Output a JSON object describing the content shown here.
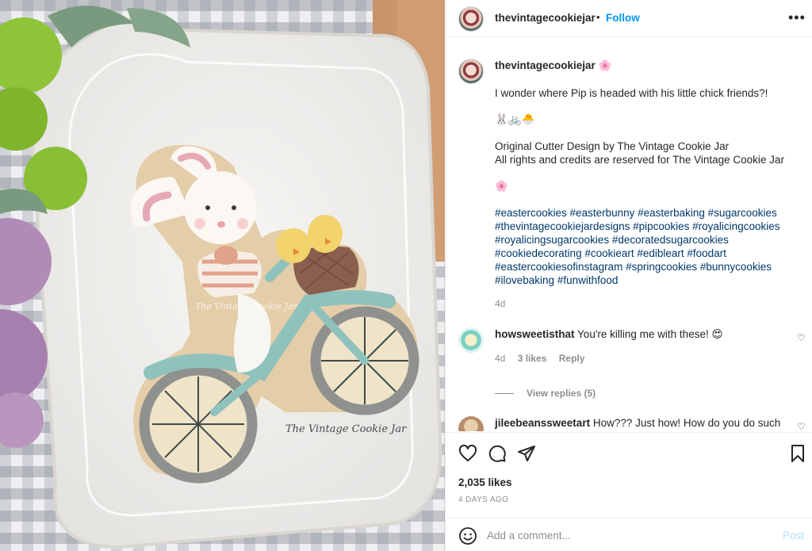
{
  "header": {
    "username": "thevintagecookiejar",
    "separator": "•",
    "follow_label": "Follow",
    "more_icon": "more-horizontal-icon",
    "more_glyph": "•••"
  },
  "photo": {
    "watermark_small": "The Vintage Cookie Jar",
    "watermark": "The Vintage Cookie Jar"
  },
  "caption": {
    "username": "thevintagecookiejar",
    "flower": "🌸",
    "line1": "I wonder where Pip is headed with his little chick friends?!",
    "emojis": "🐰🚲🐣",
    "line2": "Original Cutter Design by The Vintage Cookie Jar",
    "line3": "All rights and credits are reserved for The Vintage Cookie Jar",
    "flower2": "🌸",
    "hashtags": [
      "#eastercookies #easterbunny #easterbaking #sugarcookies",
      "#thevintagecookiejardesigns #pipcookies #royalicingcookies",
      "#royalicingsugarcookies #decoratedsugarcookies",
      "#cookiedecorating #cookieart #edibleart #foodart",
      "#eastercookiesofinstagram #springcookies #bunnycookies",
      "#ilovebaking #funwithfood"
    ],
    "time": "4d"
  },
  "comments": [
    {
      "username": "howsweetisthat",
      "text": "You're killing me with these! 😍",
      "time": "4d",
      "likes": "3 likes",
      "reply": "Reply",
      "view_replies": "View replies (5)"
    },
    {
      "username": "jileebeanssweetart",
      "text": "How??? Just how! How do you do such"
    }
  ],
  "actions": {
    "like_icon": "heart-icon",
    "comment_icon": "comment-icon",
    "share_icon": "share-icon",
    "save_icon": "bookmark-icon",
    "likes": "2,035 likes",
    "posted": "4 DAYS AGO"
  },
  "add_comment": {
    "placeholder": "Add a comment...",
    "post_label": "Post",
    "emoji_icon": "smiley-icon"
  },
  "colors": {
    "link_blue": "#0095f6",
    "hashtag": "#00376b",
    "muted": "#8e8e8e",
    "post_disabled": "#b2dffc"
  }
}
